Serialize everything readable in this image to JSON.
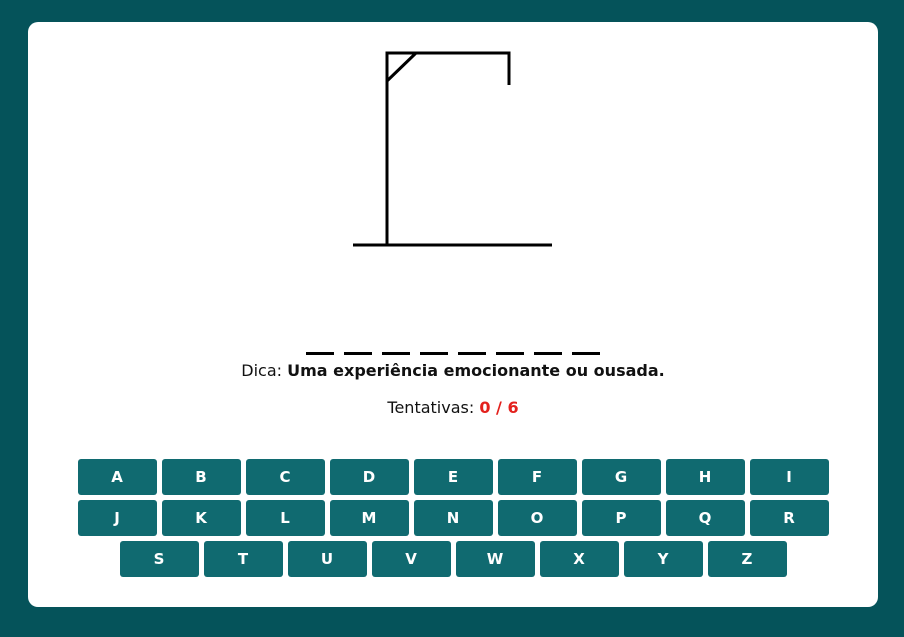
{
  "game": {
    "word_slots": [
      "",
      "",
      "",
      "",
      "",
      "",
      "",
      ""
    ],
    "hint_label": "Dica:",
    "hint_text": "Uma experiência emocionante ou ousada.",
    "tries_label": "Tentativas:",
    "tries_count": "0 / 6",
    "tries_value": 0,
    "tries_max": 6
  },
  "keyboard": {
    "rows": [
      [
        "A",
        "B",
        "C",
        "D",
        "E",
        "F",
        "G",
        "H",
        "I"
      ],
      [
        "J",
        "K",
        "L",
        "M",
        "N",
        "O",
        "P",
        "Q",
        "R"
      ],
      [
        "S",
        "T",
        "U",
        "V",
        "W",
        "X",
        "Y",
        "Z"
      ]
    ]
  },
  "colors": {
    "background": "#05535a",
    "card": "#ffffff",
    "key": "#106a70",
    "tries_count": "#e3211d"
  }
}
